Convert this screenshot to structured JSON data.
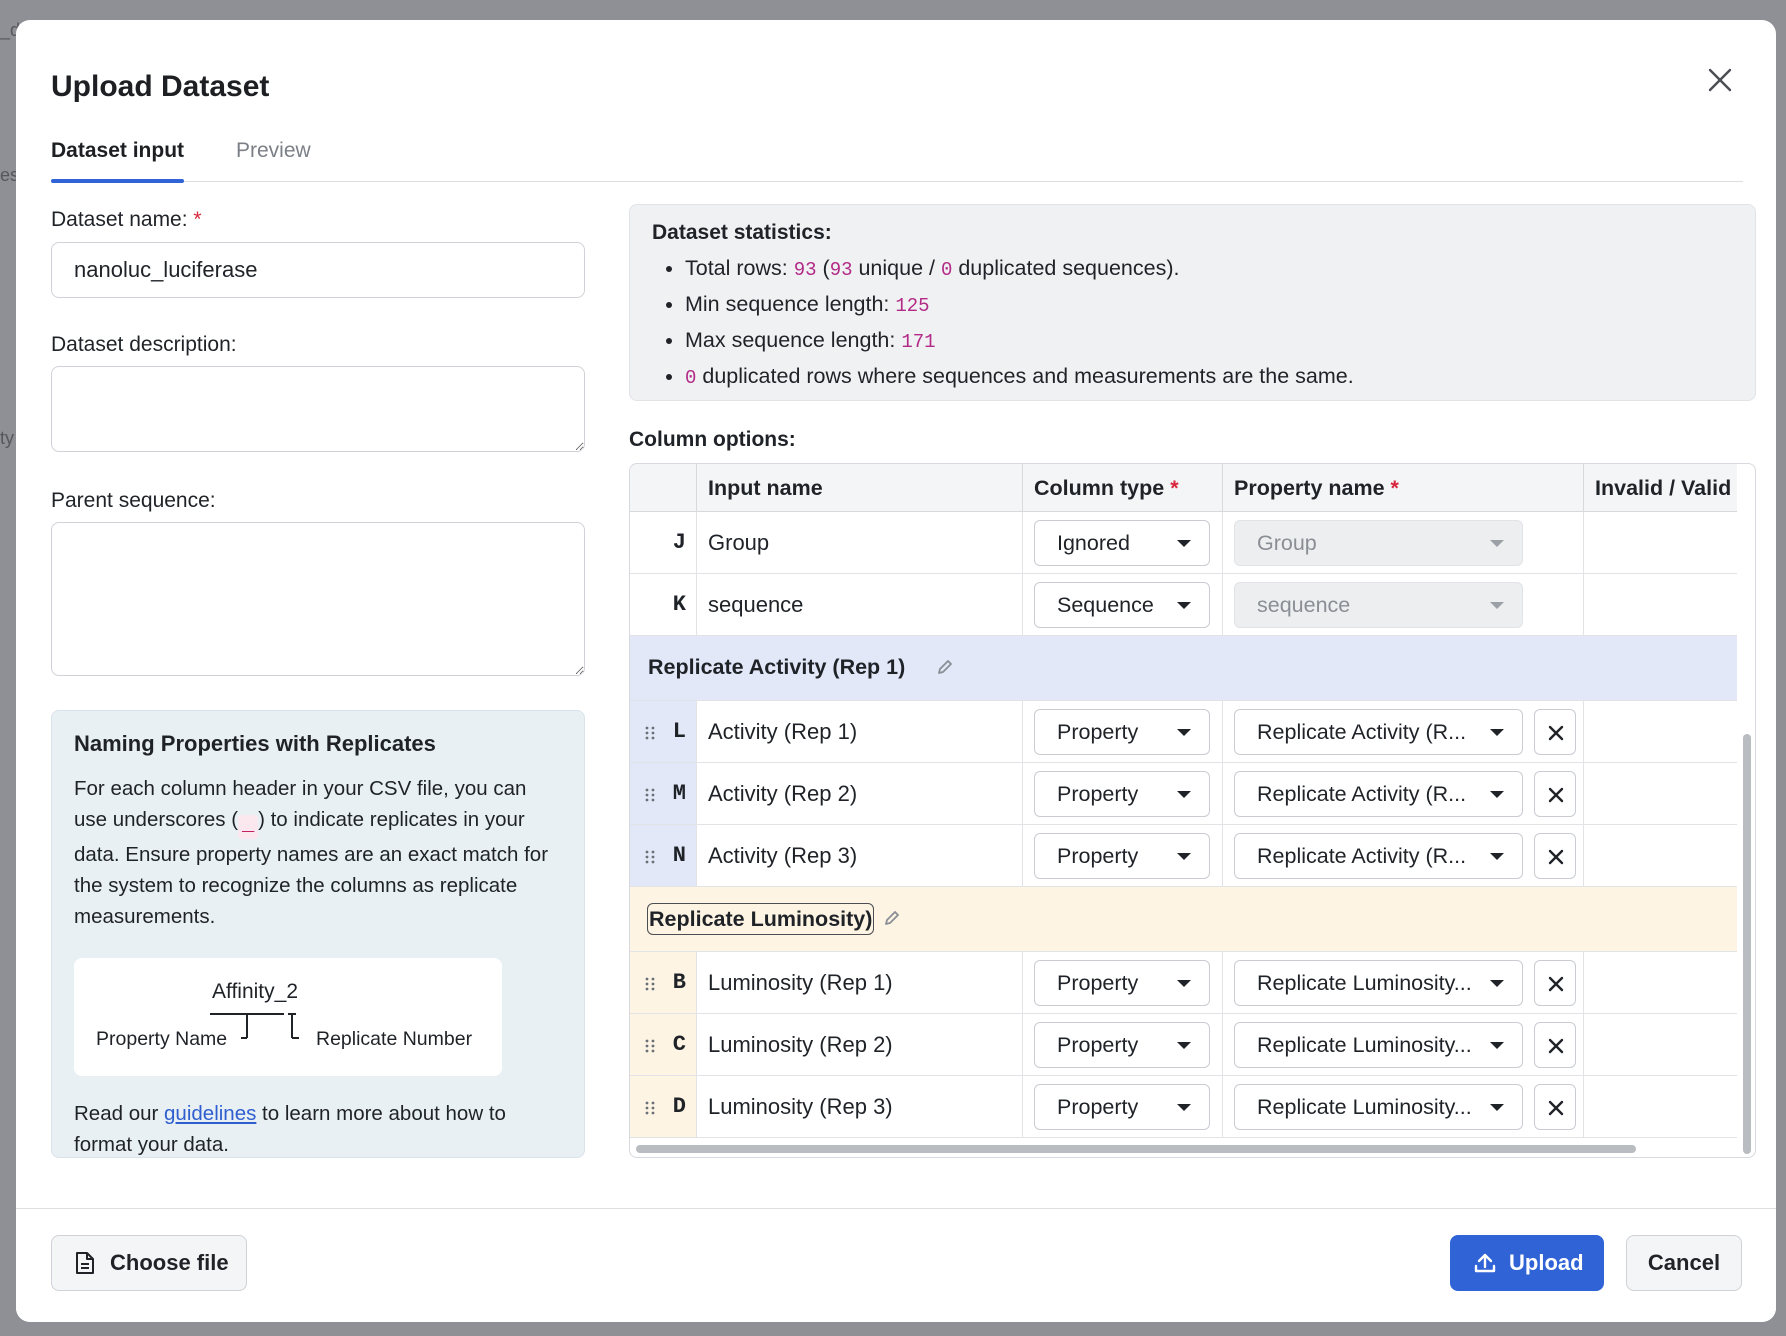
{
  "backdrop": {
    "text_1": "_d",
    "text_2": "es",
    "text_3": "ty"
  },
  "dialog": {
    "title": "Upload Dataset",
    "tabs": [
      {
        "label": "Dataset input",
        "active": true
      },
      {
        "label": "Preview",
        "active": false
      }
    ]
  },
  "form": {
    "dataset_name_label": "Dataset name:",
    "required_mark": "*",
    "dataset_name_value": "nanoluc_luciferase",
    "dataset_description_label": "Dataset description:",
    "dataset_description_value": "",
    "parent_sequence_label": "Parent sequence:",
    "parent_sequence_value": ""
  },
  "info_box": {
    "title": "Naming Properties with Replicates",
    "body_before": "For each column header in your CSV file, you can use underscores (",
    "underscore_char": "_",
    "body_after": ") to indicate replicates in your data. Ensure property names are an exact match for the system to recognize the columns as replicate measurements.",
    "diagram_example": "Affinity_2",
    "diagram_property_label": "Property Name",
    "diagram_replicate_label": "Replicate Number",
    "footer_before": "Read our ",
    "footer_link": "guidelines",
    "footer_after": " to learn more about how to format your data."
  },
  "statistics": {
    "title": "Dataset statistics:",
    "total_rows_label": "Total rows: ",
    "total_rows": "93",
    "unique_open": " (",
    "unique": "93",
    "unique_label": " unique / ",
    "duplicated": "0",
    "duplicated_label": " duplicated sequences).",
    "min_length_label": "Min sequence length: ",
    "min_length": "125",
    "max_length_label": "Max sequence length: ",
    "max_length": "171",
    "dup_rows": "0",
    "dup_rows_label": " duplicated rows where sequences and measurements are the same."
  },
  "column_options": {
    "label": "Column options:",
    "headers": {
      "input_name": "Input name",
      "column_type": "Column type",
      "property_name": "Property name",
      "invalid_valid": "Invalid / Valid"
    },
    "rows": [
      {
        "letter": "J",
        "input_name": "Group",
        "column_type": "Ignored",
        "property_name": "Group"
      },
      {
        "letter": "K",
        "input_name": "sequence",
        "column_type": "Sequence",
        "property_name": "sequence"
      }
    ],
    "groups": [
      {
        "title": "Replicate Activity (Rep 1)",
        "color": "#e3e8f8",
        "rows": [
          {
            "letter": "L",
            "input_name": "Activity (Rep 1)",
            "column_type": "Property",
            "property_name": "Replicate Activity (R..."
          },
          {
            "letter": "M",
            "input_name": "Activity (Rep 2)",
            "column_type": "Property",
            "property_name": "Replicate Activity (R..."
          },
          {
            "letter": "N",
            "input_name": "Activity (Rep 3)",
            "column_type": "Property",
            "property_name": "Replicate Activity (R..."
          }
        ]
      },
      {
        "title": "Replicate Luminosity)",
        "color": "#fdf4e3",
        "rows": [
          {
            "letter": "B",
            "input_name": "Luminosity (Rep 1)",
            "column_type": "Property",
            "property_name": "Replicate Luminosity..."
          },
          {
            "letter": "C",
            "input_name": "Luminosity (Rep 2)",
            "column_type": "Property",
            "property_name": "Replicate Luminosity..."
          },
          {
            "letter": "D",
            "input_name": "Luminosity (Rep 3)",
            "column_type": "Property",
            "property_name": "Replicate Luminosity..."
          }
        ]
      }
    ]
  },
  "footer": {
    "choose_file_label": "Choose file",
    "upload_label": "Upload",
    "cancel_label": "Cancel"
  },
  "colors": {
    "accent": "#2f63d6",
    "required": "#d7263d",
    "code": "#b22a86"
  }
}
